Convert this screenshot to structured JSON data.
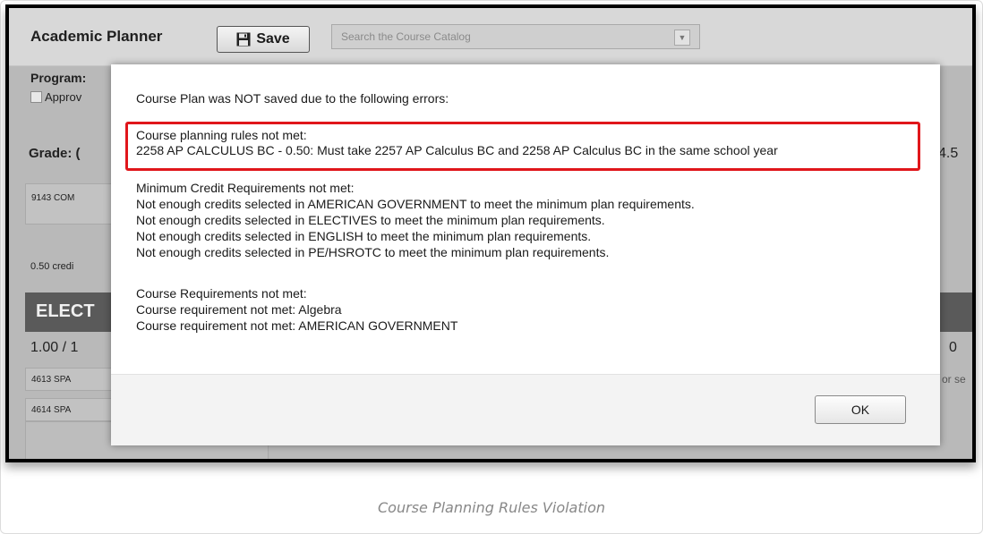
{
  "app": {
    "title": "Academic Planner",
    "save_label": "Save",
    "catalog_placeholder": "Search the Course Catalog"
  },
  "background": {
    "program_label": "Program:",
    "approve_label": "Approv",
    "grade_label": "Grade: (",
    "credit_value": "4.5",
    "course_1": "9143 COM",
    "credits_text": "0.50 credi",
    "elective_header": "ELECT",
    "ratio_text": "1.00 / 1",
    "course_2": "4613 SPA",
    "course_3": "4614 SPA",
    "right_zero": "0",
    "right_hint": "or se"
  },
  "dialog": {
    "intro": "Course Plan was NOT saved due to the following errors:",
    "rules_heading": "Course planning rules not met:",
    "rules_detail": "2258 AP CALCULUS BC - 0.50: Must take 2257 AP Calculus BC and 2258 AP Calculus BC in the same school year",
    "min_credit_heading": "Minimum Credit Requirements not met:",
    "min_credit_lines": [
      "Not enough credits selected in AMERICAN GOVERNMENT to meet the minimum plan requirements.",
      "Not enough credits selected in ELECTIVES to meet the minimum plan requirements.",
      "Not enough credits selected in ENGLISH to meet the minimum plan requirements.",
      "Not enough credits selected in PE/HSROTC to meet the minimum plan requirements."
    ],
    "course_req_heading": "Course Requirements not met:",
    "course_req_lines": [
      "Course requirement not met: Algebra",
      "Course requirement not met: AMERICAN GOVERNMENT"
    ],
    "ok_label": "OK"
  },
  "caption": "Course Planning Rules Violation",
  "colors": {
    "highlight": "#e0161b"
  }
}
